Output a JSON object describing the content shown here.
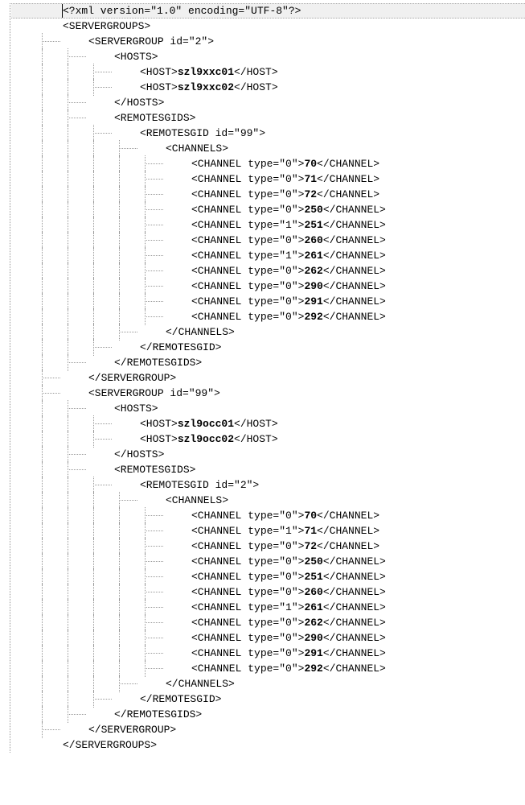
{
  "xml_decl": "<?xml version=\"1.0\" encoding=\"UTF-8\"?>",
  "root_open": "<SERVERGROUPS>",
  "root_close": "</SERVERGROUPS>",
  "groups": [
    {
      "open": "<SERVERGROUP id=\"2\">",
      "close": "</SERVERGROUP>",
      "hosts_open": "<HOSTS>",
      "hosts_close": "</HOSTS>",
      "hosts": [
        {
          "pre": "<HOST>",
          "val": "szl9xxc01",
          "post": "</HOST>"
        },
        {
          "pre": "<HOST>",
          "val": "szl9xxc02",
          "post": "</HOST>"
        }
      ],
      "remotesgids_open": "<REMOTESGIDS>",
      "remotesgids_close": "</REMOTESGIDS>",
      "remotesgid_open": "<REMOTESGID id=\"99\">",
      "remotesgid_close": "</REMOTESGID>",
      "channels_open": "<CHANNELS>",
      "channels_close": "</CHANNELS>",
      "channels": [
        {
          "pre": "<CHANNEL type=\"0\">",
          "val": "70",
          "post": "</CHANNEL>"
        },
        {
          "pre": "<CHANNEL type=\"0\">",
          "val": "71",
          "post": "</CHANNEL>"
        },
        {
          "pre": "<CHANNEL type=\"0\">",
          "val": "72",
          "post": "</CHANNEL>"
        },
        {
          "pre": "<CHANNEL type=\"0\">",
          "val": "250",
          "post": "</CHANNEL>"
        },
        {
          "pre": "<CHANNEL type=\"1\">",
          "val": "251",
          "post": "</CHANNEL>"
        },
        {
          "pre": "<CHANNEL type=\"0\">",
          "val": "260",
          "post": "</CHANNEL>"
        },
        {
          "pre": "<CHANNEL type=\"1\">",
          "val": "261",
          "post": "</CHANNEL>"
        },
        {
          "pre": "<CHANNEL type=\"0\">",
          "val": "262",
          "post": "</CHANNEL>"
        },
        {
          "pre": "<CHANNEL type=\"0\">",
          "val": "290",
          "post": "</CHANNEL>"
        },
        {
          "pre": "<CHANNEL type=\"0\">",
          "val": "291",
          "post": "</CHANNEL>"
        },
        {
          "pre": "<CHANNEL type=\"0\">",
          "val": "292",
          "post": "</CHANNEL>"
        }
      ]
    },
    {
      "open": "<SERVERGROUP id=\"99\">",
      "close": "</SERVERGROUP>",
      "hosts_open": "<HOSTS>",
      "hosts_close": "</HOSTS>",
      "hosts": [
        {
          "pre": "<HOST>",
          "val": "szl9occ01",
          "post": "</HOST>"
        },
        {
          "pre": "<HOST>",
          "val": "szl9occ02",
          "post": "</HOST>"
        }
      ],
      "remotesgids_open": "<REMOTESGIDS>",
      "remotesgids_close": "</REMOTESGIDS>",
      "remotesgid_open": "<REMOTESGID id=\"2\">",
      "remotesgid_close": "</REMOTESGID>",
      "channels_open": "<CHANNELS>",
      "channels_close": "</CHANNELS>",
      "channels": [
        {
          "pre": "<CHANNEL type=\"0\">",
          "val": "70",
          "post": "</CHANNEL>"
        },
        {
          "pre": "<CHANNEL type=\"1\">",
          "val": "71",
          "post": "</CHANNEL>"
        },
        {
          "pre": "<CHANNEL type=\"0\">",
          "val": "72",
          "post": "</CHANNEL>"
        },
        {
          "pre": "<CHANNEL type=\"0\">",
          "val": "250",
          "post": "</CHANNEL>"
        },
        {
          "pre": "<CHANNEL type=\"0\">",
          "val": "251",
          "post": "</CHANNEL>"
        },
        {
          "pre": "<CHANNEL type=\"0\">",
          "val": "260",
          "post": "</CHANNEL>"
        },
        {
          "pre": "<CHANNEL type=\"1\">",
          "val": "261",
          "post": "</CHANNEL>"
        },
        {
          "pre": "<CHANNEL type=\"0\">",
          "val": "262",
          "post": "</CHANNEL>"
        },
        {
          "pre": "<CHANNEL type=\"0\">",
          "val": "290",
          "post": "</CHANNEL>"
        },
        {
          "pre": "<CHANNEL type=\"0\">",
          "val": "291",
          "post": "</CHANNEL>"
        },
        {
          "pre": "<CHANNEL type=\"0\">",
          "val": "292",
          "post": "</CHANNEL>"
        }
      ]
    }
  ]
}
